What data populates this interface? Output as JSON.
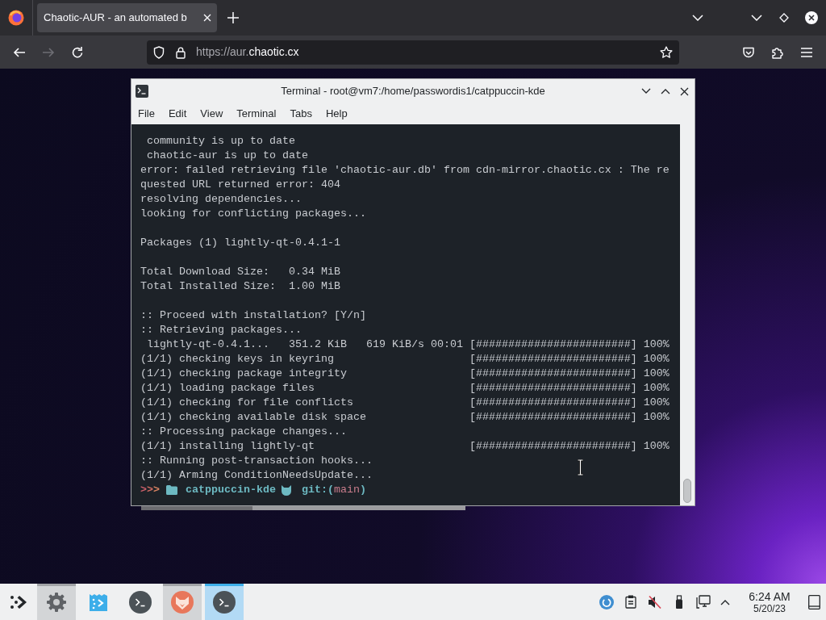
{
  "browser": {
    "tabs": [
      {
        "title": "Chaotic-AUR - an automated b",
        "selected": true
      }
    ],
    "navigation": {
      "back_disabled": false,
      "forward_disabled": true
    },
    "url": {
      "dimmed": "https://aur.",
      "domain": "chaotic.cx"
    }
  },
  "terminal": {
    "title": "Terminal - root@vm7:/home/passwordis1/catppuccin-kde",
    "menu": [
      "File",
      "Edit",
      "View",
      "Terminal",
      "Tabs",
      "Help"
    ],
    "blocks": [
      [
        " community is up to date",
        " chaotic-aur is up to date",
        "error: failed retrieving file 'chaotic-aur.db' from cdn-mirror.chaotic.cx : The re",
        "quested URL returned error: 404",
        "resolving dependencies...",
        "looking for conflicting packages..."
      ],
      [
        "Packages (1) lightly-qt-0.4.1-1"
      ],
      [
        "Total Download Size:   0.34 MiB",
        "Total Installed Size:  1.00 MiB"
      ],
      [
        ":: Proceed with installation? [Y/n]",
        ":: Retrieving packages...",
        " lightly-qt-0.4.1...   351.2 KiB   619 KiB/s 00:01 [########################] 100%",
        "(1/1) checking keys in keyring                     [########################] 100%",
        "(1/1) checking package integrity                   [########################] 100%",
        "(1/1) loading package files                        [########################] 100%",
        "(1/1) checking for file conflicts                  [########################] 100%",
        "(1/1) checking available disk space                [########################] 100%",
        ":: Processing package changes...",
        "(1/1) installing lightly-qt                        [########################] 100%",
        ":: Running post-transaction hooks...",
        "(1/1) Arming ConditionNeedsUpdate..."
      ]
    ],
    "prompt": {
      "arrows": [
        {
          "text": ">",
          "color": "#c95f6b"
        },
        {
          "text": ">",
          "color": "#cf6c62"
        },
        {
          "text": ">",
          "color": "#d88462"
        }
      ],
      "directory": "catppuccin-kde",
      "git_open": "git:(",
      "branch": "main",
      "git_close": ")"
    }
  },
  "taskbar": {
    "tasks": [
      {
        "kind": "settings",
        "running": true,
        "selected": false
      },
      {
        "kind": "store",
        "running": false,
        "selected": false
      },
      {
        "kind": "terminal",
        "running": false,
        "selected": false
      },
      {
        "kind": "browser",
        "running": true,
        "selected": false
      },
      {
        "kind": "terminal",
        "running": true,
        "selected": true
      }
    ],
    "volume_muted": true,
    "clock": {
      "time": "6:24 AM",
      "date": "5/20/23"
    }
  }
}
